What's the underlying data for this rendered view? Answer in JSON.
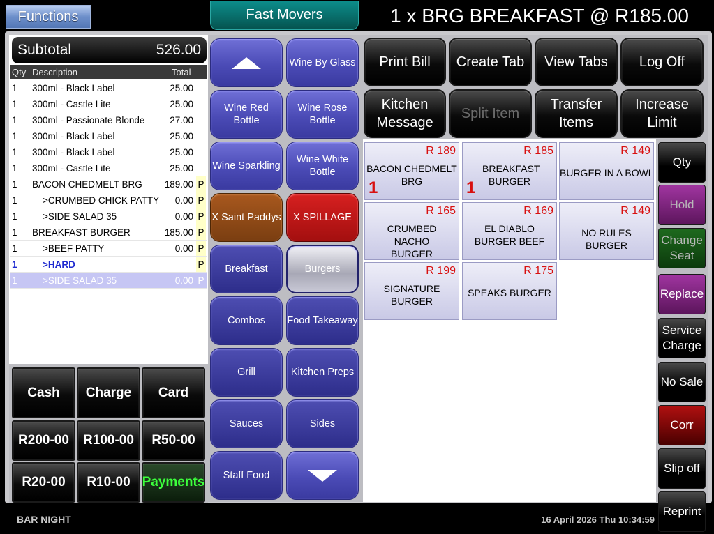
{
  "header": {
    "functions_label": "Functions",
    "fast_movers_label": "Fast Movers",
    "order_title": "1 x BRG BREAKFAST @ R185.00"
  },
  "order": {
    "subtotal_label": "Subtotal",
    "subtotal_value": "526.00",
    "columns": {
      "qty": "Qty",
      "description": "Description",
      "total": "Total"
    },
    "rows": [
      {
        "qty": "1",
        "description": "300ml - Black Label",
        "total": "25.00",
        "flag": ""
      },
      {
        "qty": "1",
        "description": "300ml - Castle Lite",
        "total": "25.00",
        "flag": ""
      },
      {
        "qty": "1",
        "description": "300ml - Passionate Blonde",
        "total": "27.00",
        "flag": ""
      },
      {
        "qty": "1",
        "description": "300ml - Black Label",
        "total": "25.00",
        "flag": ""
      },
      {
        "qty": "1",
        "description": "300ml - Black Label",
        "total": "25.00",
        "flag": ""
      },
      {
        "qty": "1",
        "description": "300ml - Castle Lite",
        "total": "25.00",
        "flag": ""
      },
      {
        "qty": "1",
        "description": "BACON CHEDMELT BRG",
        "total": "189.00",
        "flag": "P"
      },
      {
        "qty": "1",
        "description": "    >CRUMBED CHICK PATTY",
        "total": "0.00",
        "flag": "P"
      },
      {
        "qty": "1",
        "description": "    >SIDE SALAD 35",
        "total": "0.00",
        "flag": "P"
      },
      {
        "qty": "1",
        "description": "BREAKFAST BURGER",
        "total": "185.00",
        "flag": "P"
      },
      {
        "qty": "1",
        "description": "    >BEEF PATTY",
        "total": "0.00",
        "flag": "P"
      },
      {
        "qty": "1",
        "description": "    >HARD",
        "total": "",
        "flag": "P"
      },
      {
        "qty": "1",
        "description": "    >SIDE SALAD 35",
        "total": "0.00",
        "flag": "P"
      }
    ]
  },
  "payments": {
    "cash": "Cash",
    "charge": "Charge",
    "card": "Card",
    "r200": "R200-00",
    "r100": "R100-00",
    "r50": "R50-00",
    "r20": "R20-00",
    "r10": "R10-00",
    "payments": "Payments"
  },
  "categories": {
    "wine_by_glass": "Wine By Glass",
    "wine_red_bottle": "Wine Red Bottle",
    "wine_rose_bottle": "Wine Rose Bottle",
    "wine_sparkling": "Wine Sparkling",
    "wine_white_bottle": "Wine White Bottle",
    "x_saint_paddys": "X Saint Paddys",
    "x_spillage": "X SPILLAGE",
    "breakfast": "Breakfast",
    "burgers": "Burgers",
    "combos": "Combos",
    "food_takeaway": "Food Takeaway",
    "grill": "Grill",
    "kitchen_preps": "Kitchen Preps",
    "sauces": "Sauces",
    "sides": "Sides",
    "staff_food": "Staff Food"
  },
  "actions": {
    "print_bill": "Print Bill",
    "create_tab": "Create Tab",
    "view_tabs": "View Tabs",
    "log_off": "Log Off",
    "kitchen_message": "Kitchen Message",
    "split_item": "Split Item",
    "transfer_items": "Transfer Items",
    "increase_limit": "Increase Limit"
  },
  "items": [
    {
      "price": "R 189",
      "name": "BACON CHEDMELT BRG",
      "count": "1"
    },
    {
      "price": "R 185",
      "name": "BREAKFAST BURGER",
      "count": "1"
    },
    {
      "price": "R 149",
      "name": "BURGER IN A BOWL",
      "count": ""
    },
    {
      "price": "R 165",
      "name": "CRUMBED NACHO BURGER",
      "count": ""
    },
    {
      "price": "R 169",
      "name": "EL DIABLO BURGER BEEF",
      "count": ""
    },
    {
      "price": "R 149",
      "name": "NO RULES BURGER",
      "count": ""
    },
    {
      "price": "R 199",
      "name": "SIGNATURE BURGER",
      "count": ""
    },
    {
      "price": "R 175",
      "name": "SPEAKS BURGER",
      "count": ""
    }
  ],
  "side_actions": {
    "qty": "Qty",
    "hold": "Hold",
    "change_seat": "Change Seat",
    "replace": "Replace",
    "service_charge": "Service Charge",
    "no_sale": "No Sale",
    "corr": "Corr",
    "slip_off": "Slip off",
    "reprint": "Reprint"
  },
  "footer": {
    "mode": "BAR NIGHT",
    "datetime": "16 April 2026 Thu 10:34:59"
  }
}
